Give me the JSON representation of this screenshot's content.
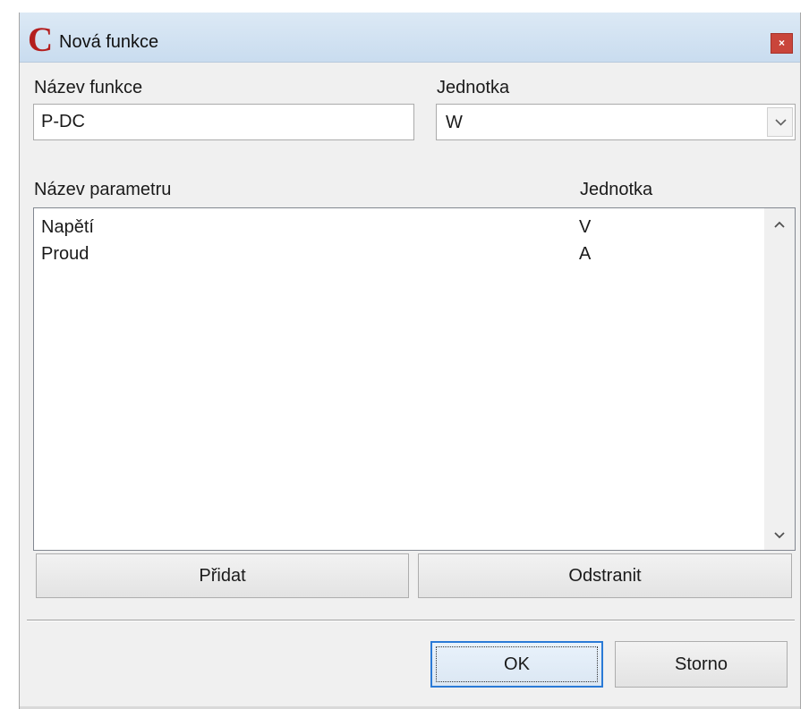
{
  "dialog": {
    "title": "Nová funkce",
    "close_label": "×",
    "app_icon_letter": "C",
    "app_icon_color": "#b41e1e"
  },
  "function_name": {
    "label": "Název funkce",
    "value": "P-DC"
  },
  "unit": {
    "label": "Jednotka",
    "selected": "W"
  },
  "parameters": {
    "column_name": "Název parametru",
    "column_unit": "Jednotka",
    "rows": [
      {
        "name": "Napětí",
        "unit": "V"
      },
      {
        "name": "Proud",
        "unit": "A"
      }
    ]
  },
  "buttons": {
    "add": "Přidat",
    "remove": "Odstranit",
    "ok": "OK",
    "cancel": "Storno"
  },
  "colors": {
    "titlebar": "#c9dcef",
    "close_button": "#c9453b",
    "default_button_border": "#2a7ad6"
  }
}
